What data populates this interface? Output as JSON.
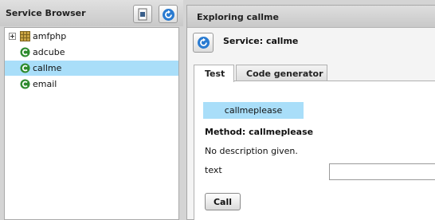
{
  "service_browser": {
    "title": "Service Browser",
    "buttons": [
      {
        "icon": "document-icon"
      },
      {
        "icon": "refresh-icon"
      }
    ],
    "tree": [
      {
        "label": "amfphp",
        "icon": "package-icon",
        "expandable": true,
        "selected": false
      },
      {
        "label": "adcube",
        "icon": "service-icon",
        "expandable": false,
        "selected": false
      },
      {
        "label": "callme",
        "icon": "service-icon",
        "expandable": false,
        "selected": true
      },
      {
        "label": "email",
        "icon": "service-icon",
        "expandable": false,
        "selected": false
      }
    ]
  },
  "explorer": {
    "title": "Exploring callme",
    "service_title": "Service: callme",
    "tabs": [
      {
        "label": "Test",
        "active": true
      },
      {
        "label": "Code generator",
        "active": false
      }
    ],
    "method_chip": "callmeplease",
    "method_label": "Method: callmeplease",
    "description": "No description given.",
    "params": [
      {
        "label": "text",
        "value": ""
      }
    ],
    "call_label": "Call"
  },
  "colors": {
    "selection": "#a9def9",
    "service_icon_green": "#2e8b2e",
    "refresh_blue": "#2a7bd1"
  }
}
